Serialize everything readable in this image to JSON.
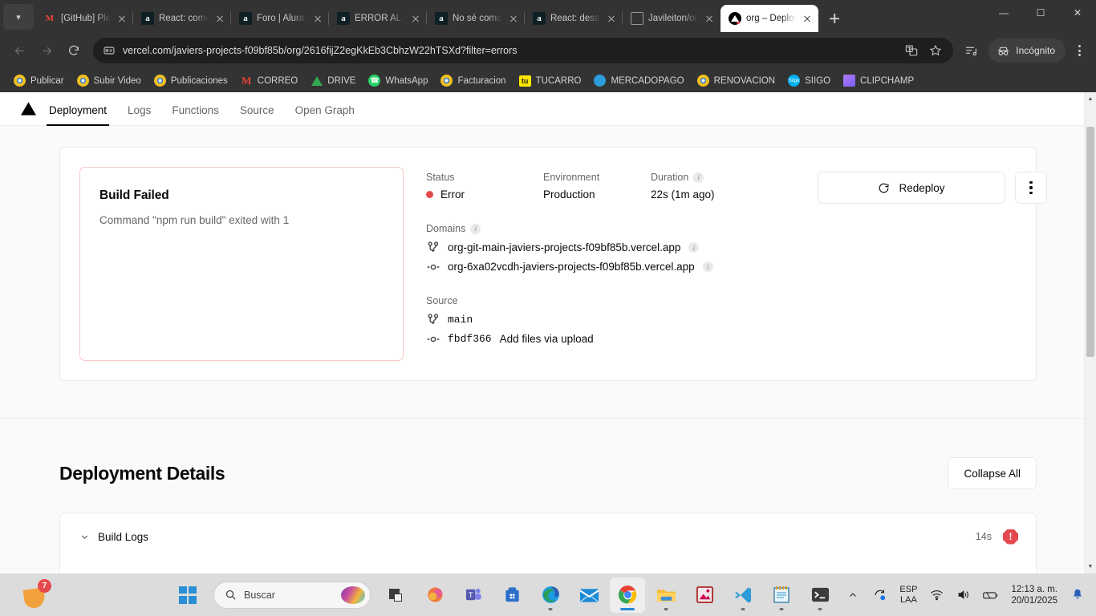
{
  "browser": {
    "tabs": [
      {
        "title": "[GitHub] Plea",
        "favicon": "gmail-icon",
        "active": false
      },
      {
        "title": "React: como",
        "favicon": "alura-icon",
        "active": false
      },
      {
        "title": "Foro | Alura L",
        "favicon": "alura-icon",
        "active": false
      },
      {
        "title": "ERROR AL SU",
        "favicon": "alura-icon",
        "active": false
      },
      {
        "title": "No sé como",
        "favicon": "alura-icon",
        "active": false
      },
      {
        "title": "React: desarr",
        "favicon": "alura-icon",
        "active": false
      },
      {
        "title": "Javileiton/org",
        "favicon": "github-icon",
        "active": false
      },
      {
        "title": "org – Deploym",
        "favicon": "vercel-icon",
        "active": true
      }
    ],
    "url": "vercel.com/javiers-projects-f09bf85b/org/2616fijZ2egKkEb3CbhzW22hTSXd?filter=errors",
    "profile_label": "Incógnito",
    "bookmarks": [
      {
        "label": "Publicar",
        "icon": "eye-icon"
      },
      {
        "label": "Subir Video",
        "icon": "eye-icon"
      },
      {
        "label": "Publicaciones",
        "icon": "eye-icon"
      },
      {
        "label": "CORREO",
        "icon": "gmail-icon"
      },
      {
        "label": "DRIVE",
        "icon": "drive-icon"
      },
      {
        "label": "WhatsApp",
        "icon": "whatsapp-icon"
      },
      {
        "label": "Facturacion",
        "icon": "eye-icon"
      },
      {
        "label": "TUCARRO",
        "icon": "tucarro-icon"
      },
      {
        "label": "MERCADOPAGO",
        "icon": "mercadopago-icon"
      },
      {
        "label": "RENOVACION",
        "icon": "eye-icon"
      },
      {
        "label": "SIIGO",
        "icon": "siigo-icon"
      },
      {
        "label": "CLIPCHAMP",
        "icon": "clipchamp-icon"
      }
    ]
  },
  "page": {
    "nav_tabs": [
      {
        "label": "Deployment",
        "active": true
      },
      {
        "label": "Logs",
        "active": false
      },
      {
        "label": "Functions",
        "active": false
      },
      {
        "label": "Source",
        "active": false
      },
      {
        "label": "Open Graph",
        "active": false
      }
    ],
    "error_panel": {
      "title": "Build Failed",
      "message": "Command \"npm run build\" exited with 1"
    },
    "meta": {
      "status_label": "Status",
      "status_value": "Error",
      "status_color": "#e5484d",
      "environment_label": "Environment",
      "environment_value": "Production",
      "duration_label": "Duration",
      "duration_value": "22s (1m ago)"
    },
    "domains": {
      "heading": "Domains",
      "items": [
        {
          "name": "org-git-main-javiers-projects-f09bf85b.vercel.app",
          "icon": "branch-icon"
        },
        {
          "name": "org-6xa02vcdh-javiers-projects-f09bf85b.vercel.app",
          "icon": "commit-icon"
        }
      ]
    },
    "source": {
      "heading": "Source",
      "branch": "main",
      "commit_hash": "fbdf366",
      "commit_message": "Add files via upload"
    },
    "actions": {
      "redeploy_label": "Redeploy",
      "more_label": "More options"
    },
    "details": {
      "title": "Deployment Details",
      "collapse_label": "Collapse All",
      "rows": [
        {
          "label": "Build Logs",
          "time": "14s",
          "status": "error"
        }
      ]
    }
  },
  "taskbar": {
    "clip_badge_count": "7",
    "search_placeholder": "Buscar",
    "apps": [
      {
        "name": "edge-icon",
        "running": true,
        "active": false
      },
      {
        "name": "mail-icon",
        "running": false,
        "active": false
      },
      {
        "name": "chrome-icon",
        "running": true,
        "active": true
      },
      {
        "name": "file-explorer-icon",
        "running": true,
        "active": false
      },
      {
        "name": "image-editor-icon",
        "running": false,
        "active": false
      },
      {
        "name": "vscode-icon",
        "running": true,
        "active": false
      },
      {
        "name": "notepad-icon",
        "running": true,
        "active": false
      },
      {
        "name": "terminal-icon",
        "running": true,
        "active": false
      }
    ],
    "pinned": [
      {
        "name": "laptop-icon"
      },
      {
        "name": "copilot-icon"
      },
      {
        "name": "teams-icon"
      },
      {
        "name": "store-icon"
      }
    ],
    "tray": {
      "language_line1": "ESP",
      "language_line2": "LAA",
      "time": "12:13 a. m.",
      "date": "20/01/2025"
    }
  }
}
